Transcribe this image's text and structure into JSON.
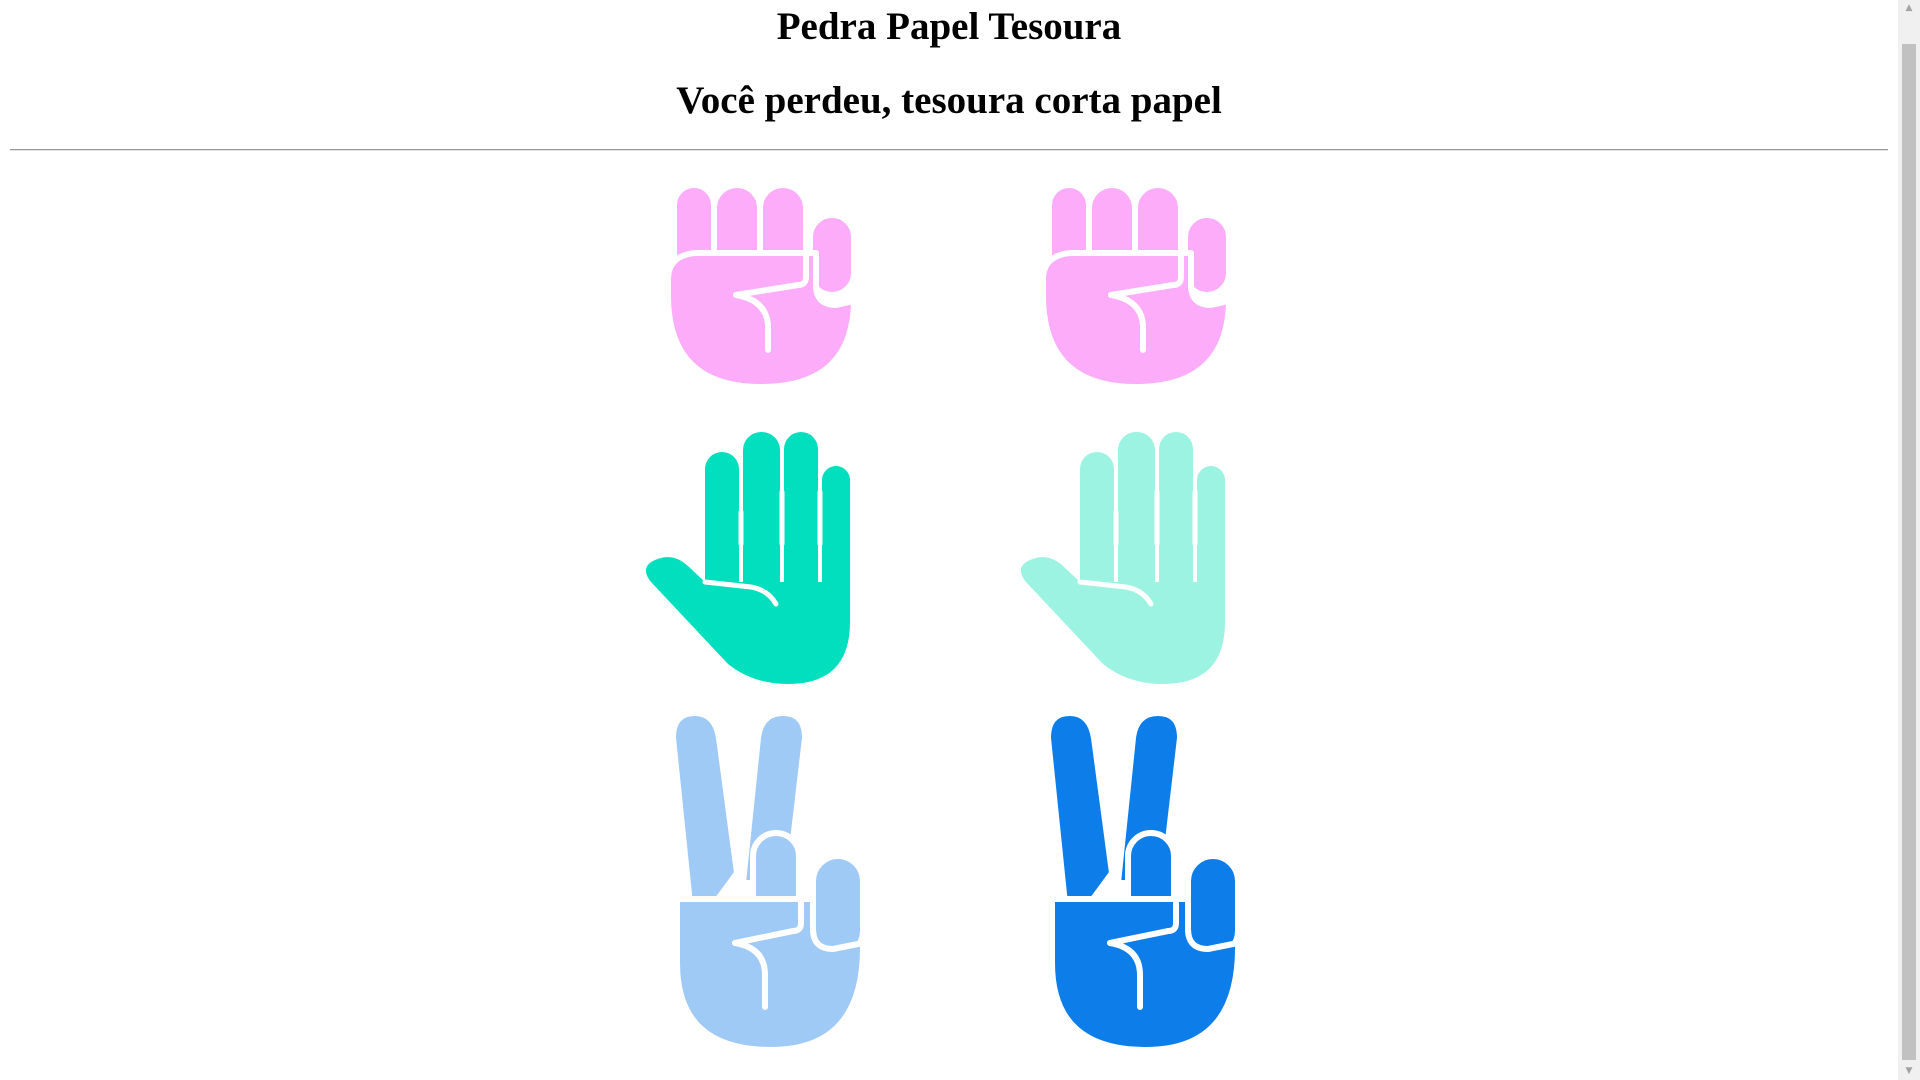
{
  "header": {
    "title": "Pedra Papel Tesoura",
    "result": "Você perdeu, tesoura corta papel"
  },
  "colors": {
    "rock": "#fdacf9",
    "paper_active": "#02dfbf",
    "paper_faded": "#9cf3e2",
    "scissors_active": "#0d7ee9",
    "scissors_faded": "#a0caf6",
    "stroke": "#ffffff"
  },
  "hands": [
    {
      "name": "rock-player",
      "icon": "fist-icon"
    },
    {
      "name": "rock-cpu",
      "icon": "fist-icon"
    },
    {
      "name": "paper-player",
      "icon": "open-hand-icon",
      "state": "selected"
    },
    {
      "name": "paper-cpu",
      "icon": "open-hand-icon",
      "state": "faded"
    },
    {
      "name": "scissors-player",
      "icon": "victory-hand-icon",
      "state": "faded"
    },
    {
      "name": "scissors-cpu",
      "icon": "victory-hand-icon",
      "state": "selected"
    }
  ],
  "scrollbar": {
    "up_icon": "scroll-up-arrow-icon",
    "down_icon": "scroll-down-arrow-icon",
    "up_glyph": "▲",
    "down_glyph": "▼"
  }
}
